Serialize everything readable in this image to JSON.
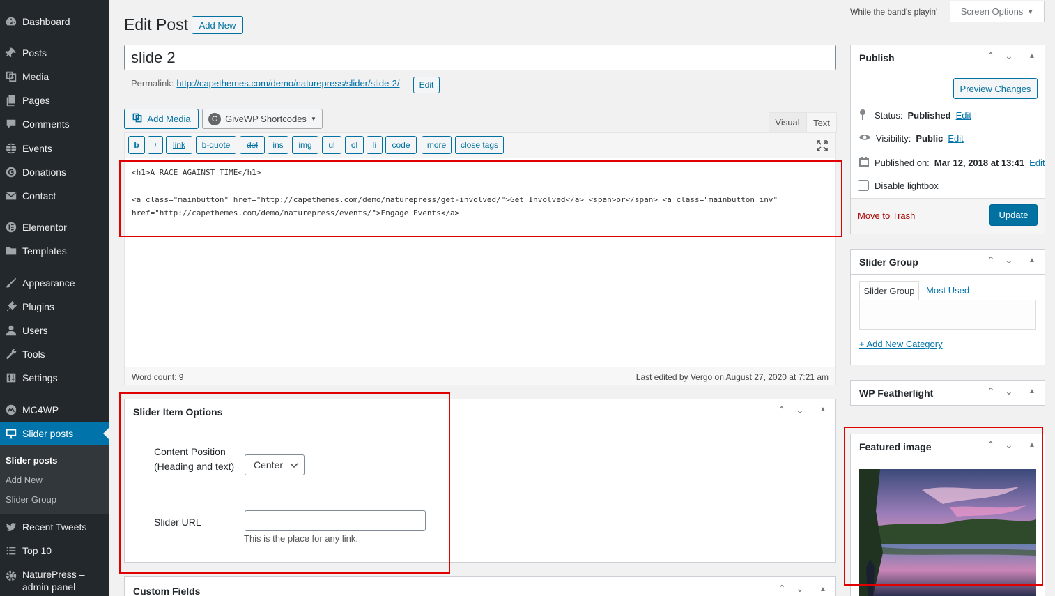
{
  "sidebar": {
    "items": [
      {
        "label": "Dashboard",
        "icon": "dashboard-icon"
      },
      {
        "label": "Posts",
        "icon": "pin-icon"
      },
      {
        "label": "Media",
        "icon": "media-icon"
      },
      {
        "label": "Pages",
        "icon": "pages-icon"
      },
      {
        "label": "Comments",
        "icon": "comment-icon"
      },
      {
        "label": "Events",
        "icon": "globe-icon"
      },
      {
        "label": "Donations",
        "icon": "donation-icon"
      },
      {
        "label": "Contact",
        "icon": "mail-icon"
      },
      {
        "label": "Elementor",
        "icon": "elementor-icon"
      },
      {
        "label": "Templates",
        "icon": "folder-icon"
      },
      {
        "label": "Appearance",
        "icon": "brush-icon"
      },
      {
        "label": "Plugins",
        "icon": "plugin-icon"
      },
      {
        "label": "Users",
        "icon": "user-icon"
      },
      {
        "label": "Tools",
        "icon": "wrench-icon"
      },
      {
        "label": "Settings",
        "icon": "settings-icon"
      },
      {
        "label": "MC4WP",
        "icon": "mc4wp-icon"
      },
      {
        "label": "Slider posts",
        "icon": "monitor-icon"
      },
      {
        "label": "Recent Tweets",
        "icon": "twitter-icon"
      },
      {
        "label": "Top 10",
        "icon": "list-icon"
      },
      {
        "label": "NaturePress – admin panel",
        "icon": "gear-icon"
      }
    ],
    "submenu": [
      "Slider posts",
      "Add New",
      "Slider Group"
    ]
  },
  "topbar": {
    "tagline": "While the band's playin'",
    "screen_options": "Screen Options"
  },
  "header": {
    "title": "Edit Post",
    "add_new": "Add New"
  },
  "post": {
    "title": "slide 2",
    "permalink_label": "Permalink:",
    "permalink_url": "http://capethemes.com/demo/naturepress/slider/slide-2/",
    "permalink_edit": "Edit"
  },
  "editor": {
    "add_media": "Add Media",
    "givewp": "GiveWP Shortcodes",
    "tab_visual": "Visual",
    "tab_text": "Text",
    "quicktags": [
      "b",
      "i",
      "link",
      "b-quote",
      "del",
      "ins",
      "img",
      "ul",
      "ol",
      "li",
      "code",
      "more",
      "close tags"
    ],
    "content_line1": "<h1>A RACE AGAINST TIME</h1>",
    "content_line2": "<a class=\"mainbutton\" href=\"http://capethemes.com/demo/naturepress/get-involved/\">Get Involved</a> <span>or</span> <a class=\"mainbutton inv\"",
    "content_line3": "href=\"http://capethemes.com/demo/naturepress/events/\">Engage Events</a>",
    "word_count": "Word count: 9",
    "last_edited": "Last edited by Vergo on August 27, 2020 at 7:21 am"
  },
  "slider_options": {
    "title": "Slider Item Options",
    "content_position_label": "Content Position (Heading and text)",
    "content_position_value": "Center",
    "slider_url_label": "Slider URL",
    "slider_url_value": "",
    "slider_url_help": "This is the place for any link."
  },
  "custom_fields": {
    "title": "Custom Fields"
  },
  "publish": {
    "title": "Publish",
    "preview": "Preview Changes",
    "status_label": "Status:",
    "status_value": "Published",
    "visibility_label": "Visibility:",
    "visibility_value": "Public",
    "published_label": "Published on:",
    "published_value": "Mar 12, 2018 at 13:41",
    "edit": "Edit",
    "disable_lightbox": "Disable lightbox",
    "trash": "Move to Trash",
    "update": "Update"
  },
  "slider_group": {
    "title": "Slider Group",
    "tab_all": "Slider Group",
    "tab_most_used": "Most Used",
    "add_new_category": "+ Add New Category"
  },
  "featherlight": {
    "title": "WP Featherlight"
  },
  "featured_image": {
    "title": "Featured image"
  },
  "colors": {
    "accent": "#0073aa",
    "sidebar": "#23282d",
    "highlight": "#e10000"
  }
}
